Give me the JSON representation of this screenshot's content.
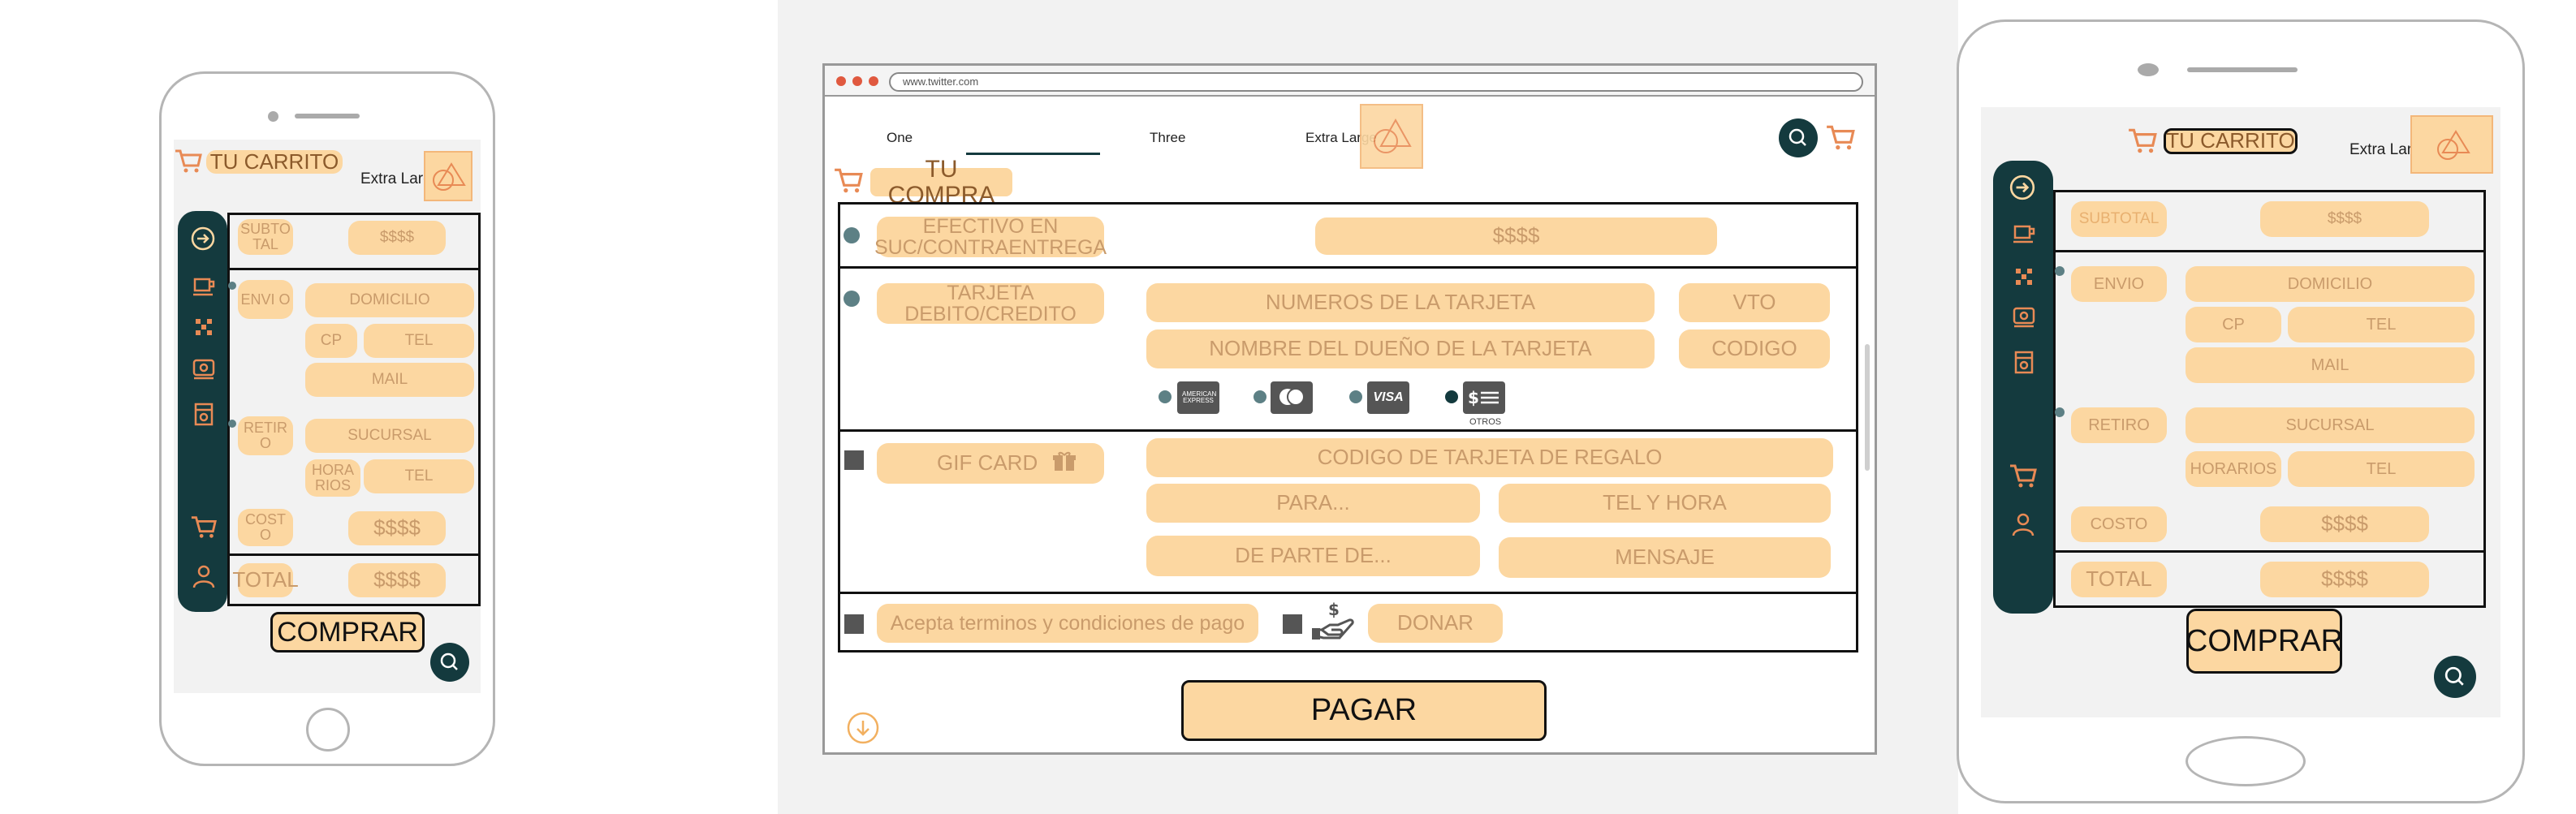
{
  "colors": {
    "accent": "#fcd7a1",
    "accent_text": "#c99b6b",
    "sidebar": "#143a3e",
    "icon": "#e88a55",
    "bg_panel": "#f2f2f2"
  },
  "left_phone": {
    "cart_title": "TU CARRITO",
    "extra_large": "Extra Large",
    "subtotal": "SUBTO TAL",
    "subtotal_value": "$$$$",
    "envio": "ENVI O",
    "domicilio": "DOMICILIO",
    "cp": "CP",
    "tel": "TEL",
    "mail": "MAIL",
    "retiro": "RETIR O",
    "sucursal": "SUCURSAL",
    "horarios": "HORA RIOS",
    "tel2": "TEL",
    "costo": "COST O",
    "costo_value": "$$$$",
    "total": "TOTAL",
    "total_value": "$$$$",
    "comprar": "COMPRAR"
  },
  "browser": {
    "url": "www.twitter.com",
    "tabs": [
      "One",
      "",
      "Three",
      "Extra Large"
    ],
    "page_title": "TU COMPRA",
    "efectivo": "EFECTIVO EN SUC/CONTRAENTREGA",
    "efectivo_value": "$$$$",
    "tarjeta": "TARJETA DEBITO/CREDITO",
    "numeros": "NUMEROS DE LA TARJETA",
    "vto": "VTO",
    "nombre": "NOMBRE DEL DUEÑO DE LA TARJETA",
    "codigo": "CODIGO",
    "card_amex": "AMERICAN EXPRESS",
    "card_visa": "VISA",
    "card_otros": "OTROS",
    "gifcard": "GIF CARD",
    "codigo_regalo": "CODIGO DE TARJETA DE REGALO",
    "para": "PARA...",
    "tel_hora": "TEL Y HORA",
    "de_parte": "DE PARTE DE...",
    "mensaje": "MENSAJE",
    "terminos": "Acepta terminos y condiciones de pago",
    "donar": "DONAR",
    "pagar": "PAGAR"
  },
  "right_tablet": {
    "cart_title": "TU CARRITO",
    "extra_large": "Extra Large",
    "subtotal": "SUBTOTAL",
    "subtotal_value": "$$$$",
    "envio": "ENVIO",
    "domicilio": "DOMICILIO",
    "cp": "CP",
    "tel": "TEL",
    "mail": "MAIL",
    "retiro": "RETIRO",
    "sucursal": "SUCURSAL",
    "horarios": "HORARIOS",
    "tel2": "TEL",
    "costo": "COSTO",
    "costo_value": "$$$$",
    "total": "TOTAL",
    "total_value": "$$$$",
    "comprar": "COMPRAR"
  }
}
